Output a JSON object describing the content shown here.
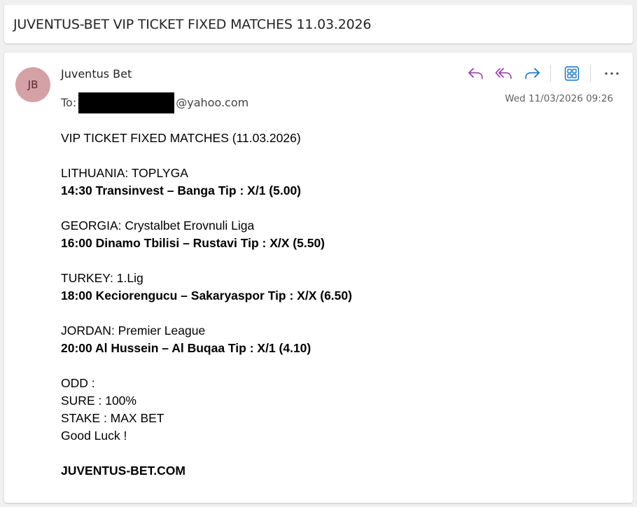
{
  "subject": "JUVENTUS-BET VIP TICKET FIXED MATCHES 11.03.2026",
  "message": {
    "avatar_initials": "JB",
    "sender": "Juventus Bet",
    "to_label": "To:",
    "to_domain": "@yahoo.com",
    "datetime": "Wed 11/03/2026 09:26"
  },
  "toolbar": {
    "reply": "reply-icon",
    "reply_all": "reply-all-icon",
    "forward": "forward-icon",
    "apps": "apps-icon",
    "more": "more-icon"
  },
  "body": {
    "heading": "VIP TICKET FIXED MATCHES (11.03.2026)",
    "matches": [
      {
        "league": "LITHUANIA: TOPLYGA",
        "pick": "14:30  Transinvest – Banga  Tip : X/1 (5.00)"
      },
      {
        "league": "GEORGIA: Crystalbet Erovnuli Liga",
        "pick": "16:00  Dinamo Tbilisi – Rustavi  Tip : X/X (5.50)"
      },
      {
        "league": "TURKEY: 1.Lig",
        "pick": "18:00  Keciorengucu – Sakaryaspor   Tip : X/X (6.50)"
      },
      {
        "league": "JORDAN: Premier League",
        "pick": "20:00  Al Hussein – Al Buqaa  Tip : X/1 (4.10)"
      }
    ],
    "odd": "ODD :",
    "sure": "SURE : 100%",
    "stake": "STAKE : MAX BET",
    "luck": "Good Luck !",
    "signature": "JUVENTUS-BET.COM"
  },
  "colors": {
    "accent_purple": "#8e3a9f",
    "accent_blue": "#0f6cbd",
    "avatar_bg": "#d3a1a6"
  }
}
